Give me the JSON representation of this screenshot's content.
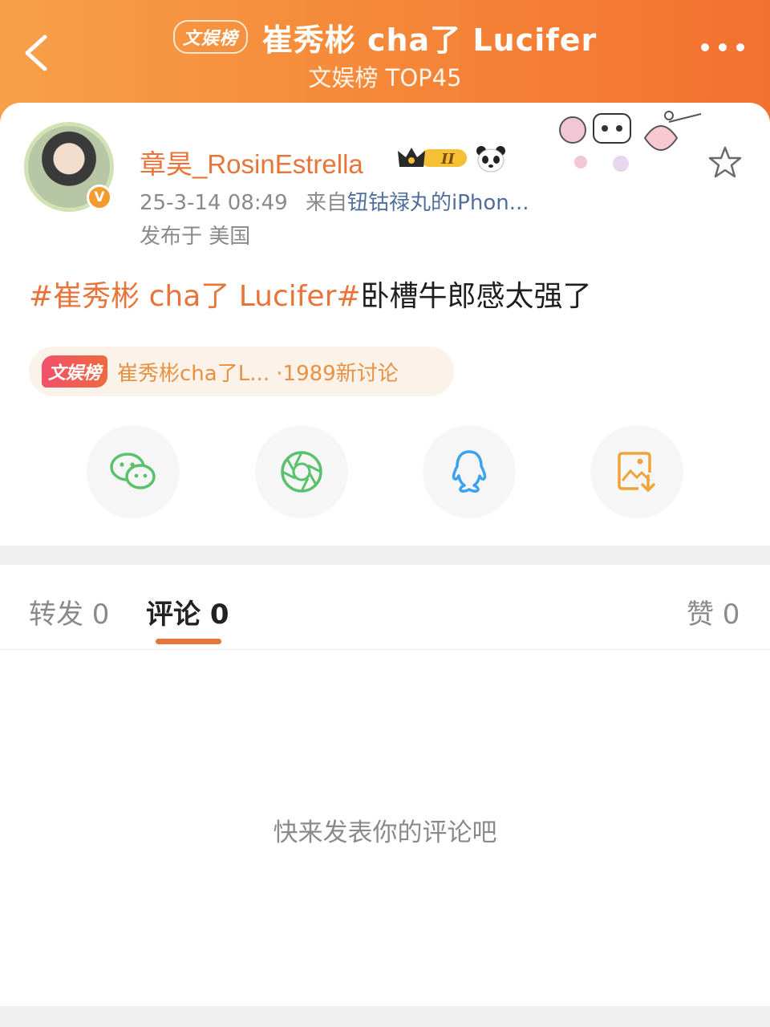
{
  "header": {
    "badge": "文娱榜",
    "title": "崔秀彬 cha了 Lucifer",
    "subtitle": "文娱榜 TOP45",
    "back_icon": "chevron-left-icon",
    "more_icon": "more-dots-icon"
  },
  "post": {
    "username": "章昊_RosinEstrella",
    "time": "25-3-14 08:49",
    "source_prefix": "来自",
    "source": "钮钴禄丸的iPhon...",
    "location": "发布于 美国",
    "topic": "#崔秀彬 cha了 Lucifer#",
    "body": "卧槽牛郎感太强了",
    "verified_icon": "verified-v-icon",
    "vip_icon": "crown-level-icon",
    "panda_icon": "panda-icon",
    "star_icon": "star-icon"
  },
  "topic_card": {
    "badge": "文娱榜",
    "text": "崔秀彬cha了L... ·1989新讨论"
  },
  "share": {
    "items": [
      "wechat-icon",
      "moments-icon",
      "qq-icon",
      "save-image-icon"
    ]
  },
  "tabs": {
    "repost": "转发 0",
    "comment": "评论 0",
    "like": "赞 0"
  },
  "comments": {
    "empty_text": "快来发表你的评论吧"
  },
  "colors": {
    "accent": "#e8743a",
    "header_start": "#f7a04a",
    "header_end": "#f3712f"
  }
}
